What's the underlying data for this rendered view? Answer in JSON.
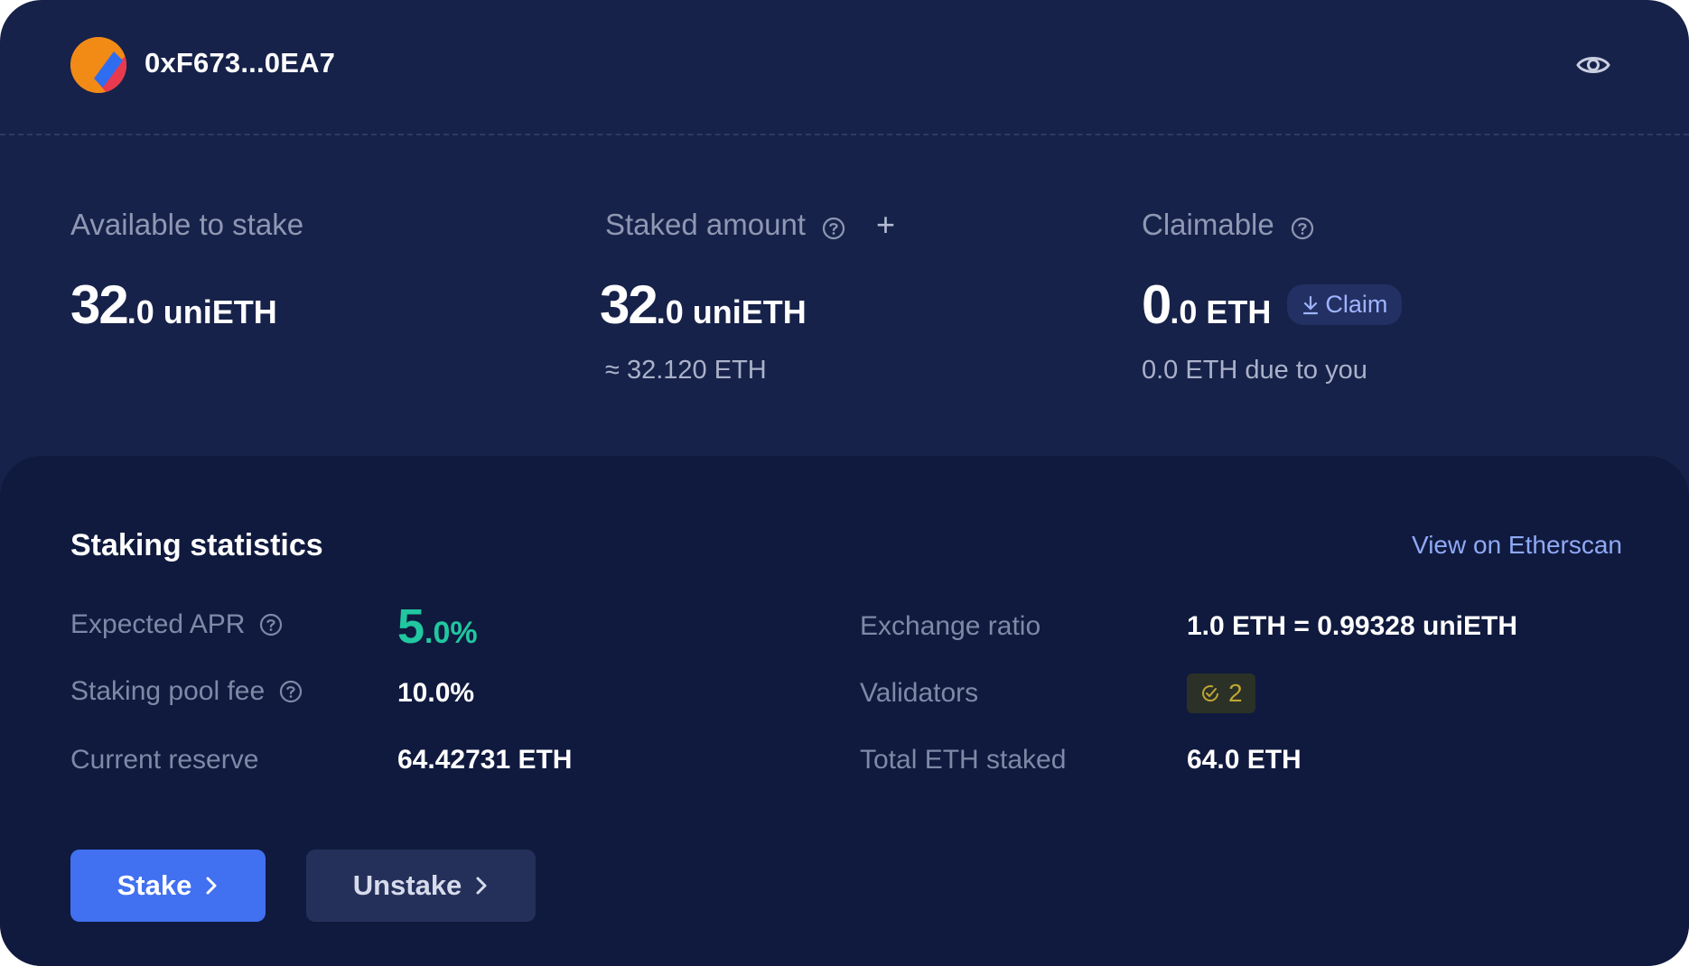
{
  "wallet": {
    "address": "0xF673...0EA7",
    "avatar_icon": "gradient-avatar-icon",
    "visibility_icon": "eye-icon"
  },
  "balances": {
    "available": {
      "label": "Available to stake",
      "int": "32",
      "dec": ".0",
      "unit": "uniETH"
    },
    "staked": {
      "label": "Staked amount",
      "int": "32",
      "dec": ".0",
      "unit": "uniETH",
      "approx": "≈ 32.120 ETH"
    },
    "claimable": {
      "label": "Claimable",
      "int": "0",
      "dec": ".0",
      "unit": "ETH",
      "claim_label": "Claim",
      "due_text": "0.0 ETH due to you"
    }
  },
  "stats": {
    "title": "Staking statistics",
    "etherscan_link": "View on Etherscan",
    "apr_label": "Expected APR",
    "apr_int": "5",
    "apr_dec": ".0%",
    "fee_label": "Staking pool fee",
    "fee_value": "10.0%",
    "reserve_label": "Current reserve",
    "reserve_value": "64.42731 ETH",
    "ratio_label": "Exchange ratio",
    "ratio_value": "1.0 ETH = 0.99328 uniETH",
    "validators_label": "Validators",
    "validators_count": "2",
    "total_label": "Total ETH staked",
    "total_value": "64.0 ETH"
  },
  "actions": {
    "stake_label": "Stake",
    "unstake_label": "Unstake"
  },
  "colors": {
    "card_bg": "#17224a",
    "panel_bg": "#101a3e",
    "accent_blue": "#4170f0",
    "apr_green": "#21c7a0",
    "link_blue": "#8fa9f5"
  }
}
